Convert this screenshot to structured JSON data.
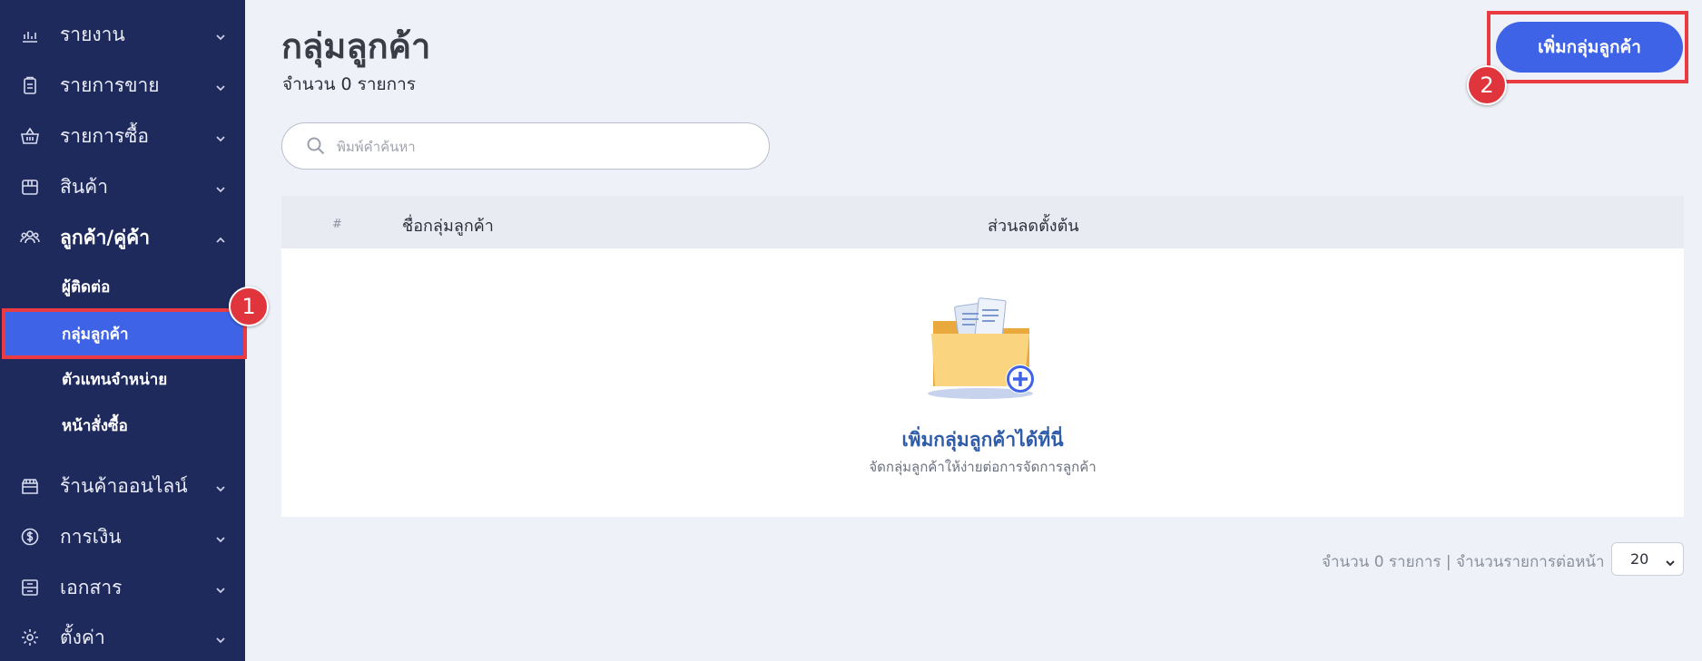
{
  "sidebar": {
    "items": [
      {
        "label": "รายงาน",
        "icon": "chart-icon"
      },
      {
        "label": "รายการขาย",
        "icon": "clipboard-icon"
      },
      {
        "label": "รายการซื้อ",
        "icon": "basket-icon"
      },
      {
        "label": "สินค้า",
        "icon": "box-icon"
      },
      {
        "label": "ลูกค้า/คู่ค้า",
        "icon": "users-icon"
      },
      {
        "label": "ร้านค้าออนไลน์",
        "icon": "store-icon"
      },
      {
        "label": "การเงิน",
        "icon": "money-icon"
      },
      {
        "label": "เอกสาร",
        "icon": "archive-icon"
      },
      {
        "label": "ตั้งค่า",
        "icon": "gear-icon"
      }
    ],
    "subitems": [
      {
        "label": "ผู้ติดต่อ"
      },
      {
        "label": "กลุ่มลูกค้า"
      },
      {
        "label": "ตัวแทนจำหน่าย"
      },
      {
        "label": "หน้าสั่งซื้อ"
      }
    ]
  },
  "markers": {
    "one": "1",
    "two": "2"
  },
  "header": {
    "title": "กลุ่มลูกค้า",
    "count": "จำนวน 0 รายการ",
    "add_button": "เพิ่มกลุ่มลูกค้า"
  },
  "search": {
    "placeholder": "พิมพ์คำค้นหา"
  },
  "table": {
    "columns": [
      "#",
      "ชื่อกลุ่มลูกค้า",
      "ส่วนลดตั้งต้น"
    ],
    "empty_title": "เพิ่มกลุ่มลูกค้าได้ที่นี่",
    "empty_subtitle": "จัดกลุ่มลูกค้าให้ง่ายต่อการจัดการลูกค้า"
  },
  "pagination": {
    "summary": "จำนวน 0 รายการ | จำนวนรายการต่อหน้า",
    "page_size": "20"
  },
  "colors": {
    "sidebar_bg": "#1f2a5c",
    "accent": "#3f63e6",
    "highlight": "#ea3b43",
    "empty_title": "#2f5ca8"
  }
}
